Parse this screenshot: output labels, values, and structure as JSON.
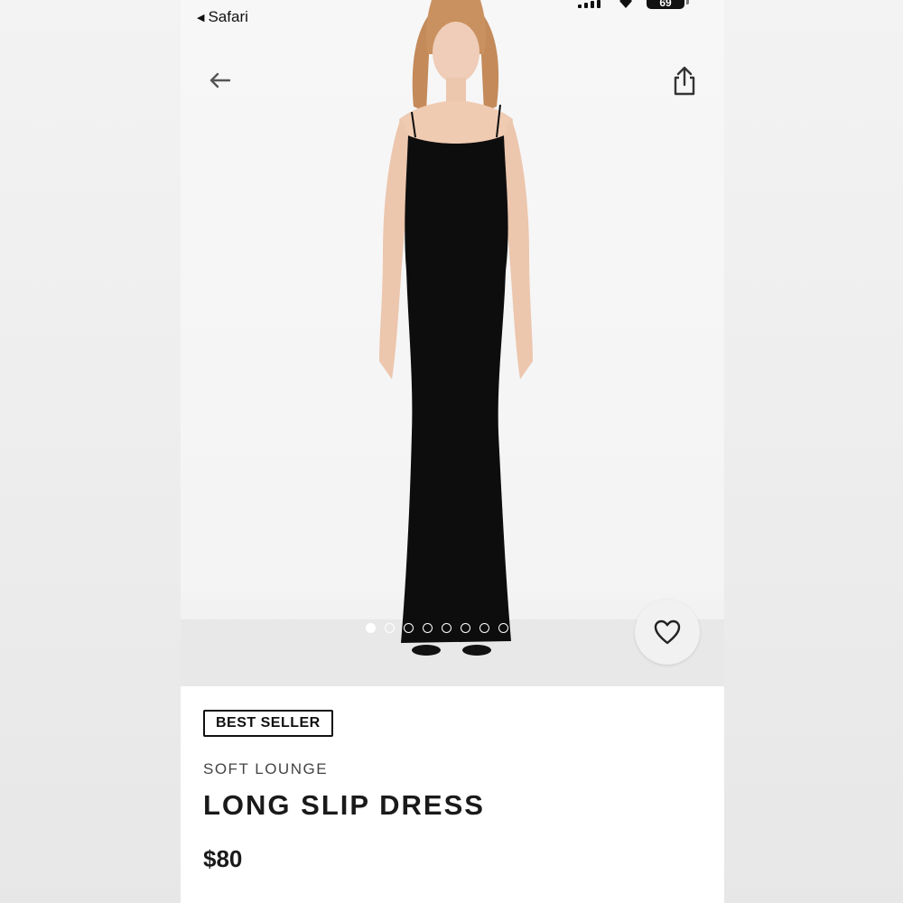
{
  "status_bar": {
    "back_app_label": "Safari",
    "battery_level": "69"
  },
  "product_gallery": {
    "image_count": 8,
    "active_index": 0
  },
  "product": {
    "badge": "BEST SELLER",
    "collection": "SOFT LOUNGE",
    "title": "LONG SLIP DRESS",
    "price": "$80"
  },
  "icons": {
    "back": "arrow-left-icon",
    "share": "share-icon",
    "favorite": "heart-icon"
  },
  "colors": {
    "dress": "#0d0d0d",
    "text": "#1a1a1a",
    "background": "#f4f4f4"
  }
}
